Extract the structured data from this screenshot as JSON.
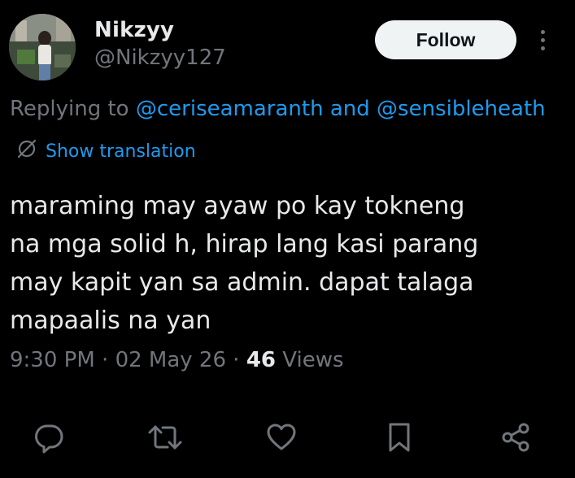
{
  "author": {
    "display_name": "Nikzyy",
    "handle": "@Nikzyy127",
    "avatar_icon": "profile-photo"
  },
  "header": {
    "follow_label": "Follow",
    "more_icon": "more-options-icon"
  },
  "reply_context": {
    "prefix": "Replying to ",
    "mention_1": "@ceriseamaranth",
    "conjunction": " and ",
    "mention_2": "@sensibleheath"
  },
  "translation": {
    "label": "Show translation",
    "icon": "globe-slash-icon"
  },
  "tweet": {
    "text": "maraming may ayaw po kay tokneng\nna mga solid h, hirap lang kasi parang\nmay kapit yan sa admin. dapat talaga\nmapaalis na yan"
  },
  "meta": {
    "time": "9:30 PM",
    "separator": " · ",
    "date": "02 May 26",
    "views_count": "46",
    "views_label": " Views"
  },
  "actions": [
    {
      "name": "reply-icon"
    },
    {
      "name": "retweet-icon"
    },
    {
      "name": "like-icon"
    },
    {
      "name": "bookmark-icon"
    },
    {
      "name": "share-icon"
    }
  ],
  "colors": {
    "background": "#000000",
    "primary_text": "#e7e9ea",
    "secondary_text": "#71767b",
    "accent": "#1d9bf0",
    "follow_bg": "#eff3f4"
  }
}
